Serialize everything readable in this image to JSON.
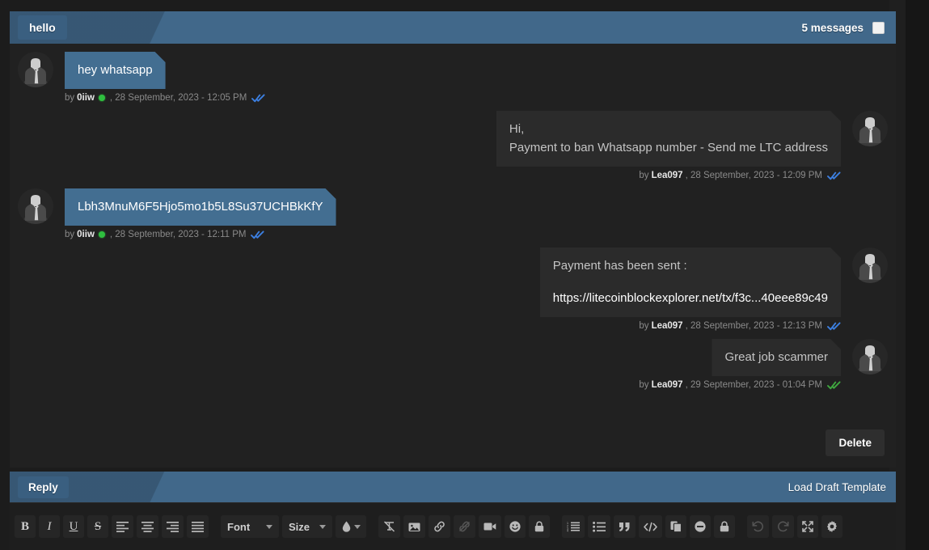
{
  "header": {
    "tab_label": "hello",
    "message_count_label": "5 messages",
    "select_all_checkbox": "unchecked"
  },
  "theme": {
    "page_bg": "#1c1c1c",
    "panel_bg": "#212121",
    "accent_blue": "#41688a",
    "bubble_out": "#436e91",
    "bubble_in": "#2b2b2b",
    "online_green": "#2fbf3f",
    "tick_blue": "#3c7fe0",
    "tick_green": "#3fa83f"
  },
  "messages": [
    {
      "side": "left",
      "author": "0iiw",
      "online": true,
      "text": "hey whatsapp",
      "link": "",
      "by_label": "by",
      "timestamp": ", 28 September, 2023 - 12:05 PM",
      "read_state": "read-blue"
    },
    {
      "side": "right",
      "author": "Lea097",
      "online": false,
      "text": "Hi,\nPayment to ban Whatsapp number - Send me LTC address",
      "link": "",
      "by_label": "by",
      "timestamp": ", 28 September, 2023 - 12:09 PM",
      "read_state": "read-blue"
    },
    {
      "side": "left",
      "author": "0iiw",
      "online": true,
      "text": "Lbh3MnuM6F5Hjo5mo1b5L8Su37UCHBkKfY",
      "link": "",
      "by_label": "by",
      "timestamp": ", 28 September, 2023 - 12:11 PM",
      "read_state": "read-blue"
    },
    {
      "side": "right",
      "author": "Lea097",
      "online": false,
      "text": "Payment has been sent :",
      "link": "https://litecoinblockexplorer.net/tx/f3c...40eee89c49",
      "by_label": "by",
      "timestamp": ", 28 September, 2023 - 12:13 PM",
      "read_state": "read-blue"
    },
    {
      "side": "right",
      "author": "Lea097",
      "online": false,
      "text": "Great job scammer",
      "link": "",
      "by_label": "by",
      "timestamp": ", 29 September, 2023 - 01:04 PM",
      "read_state": "read-green"
    }
  ],
  "actions": {
    "delete_label": "Delete"
  },
  "reply_bar": {
    "reply_label": "Reply",
    "load_draft_label": "Load Draft Template"
  },
  "toolbar": {
    "bold": "B",
    "italic": "I",
    "underline": "U",
    "strikethrough": "S",
    "font_label": "Font",
    "size_label": "Size",
    "items": [
      "bold-icon",
      "italic-icon",
      "underline-icon",
      "strikethrough-icon",
      "align-left-icon",
      "align-center-icon",
      "align-right-icon",
      "align-justify-icon",
      "font-dropdown",
      "size-dropdown",
      "text-color-icon",
      "remove-format-icon",
      "image-icon",
      "link-icon",
      "unlink-icon",
      "video-icon",
      "emoji-icon",
      "lock-icon",
      "ordered-list-icon",
      "unordered-list-icon",
      "quote-icon",
      "code-icon",
      "paste-icon",
      "minus-circle-icon",
      "lock-icon",
      "undo-icon",
      "redo-icon",
      "fullscreen-icon",
      "gear-icon"
    ]
  }
}
